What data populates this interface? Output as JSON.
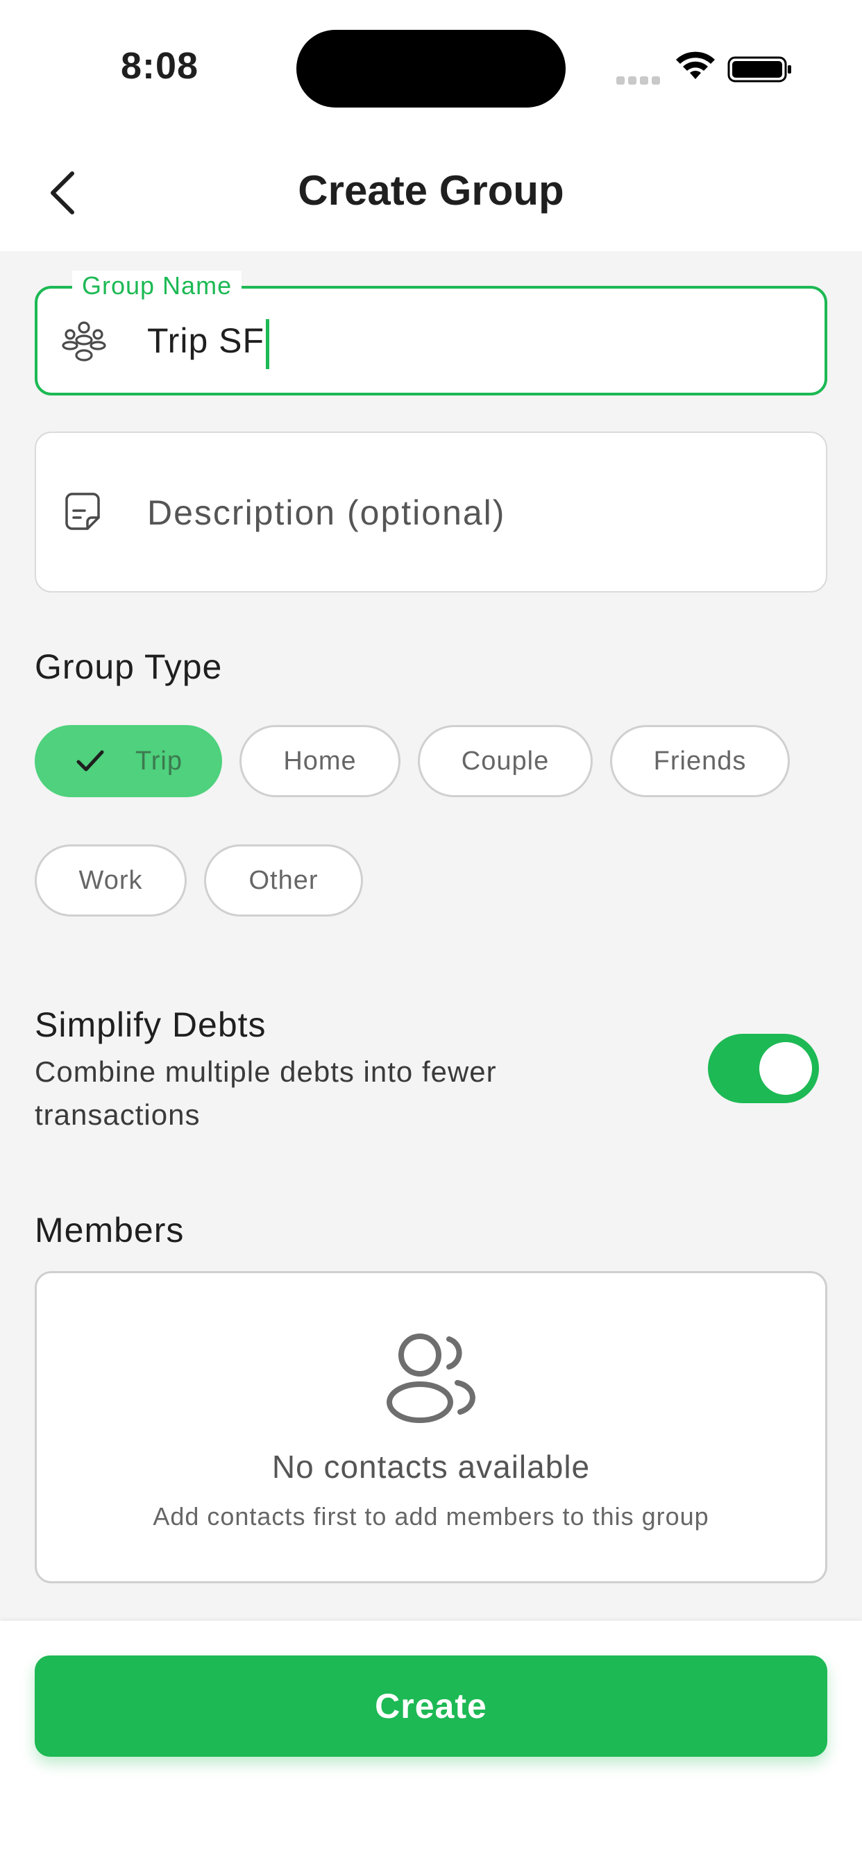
{
  "status_bar": {
    "time": "8:08"
  },
  "header": {
    "title": "Create Group",
    "back_icon": "chevron-left-icon"
  },
  "group_name": {
    "label": "Group Name",
    "value": "Trip SF",
    "icon": "group-icon"
  },
  "description": {
    "placeholder": "Description (optional)",
    "icon": "document-icon"
  },
  "group_type": {
    "title": "Group Type",
    "options": [
      "Trip",
      "Home",
      "Couple",
      "Friends",
      "Work",
      "Other"
    ],
    "selected": "Trip"
  },
  "simplify": {
    "title": "Simplify Debts",
    "subtitle": "Combine multiple debts into fewer transactions",
    "enabled": true
  },
  "members": {
    "title": "Members",
    "empty_title": "No contacts available",
    "empty_subtitle": "Add contacts first to add members to this group",
    "icon": "people-icon"
  },
  "footer": {
    "create_label": "Create"
  },
  "colors": {
    "accent": "#1db954",
    "chip_selected": "#4fd17d",
    "background": "#f4f4f4"
  }
}
